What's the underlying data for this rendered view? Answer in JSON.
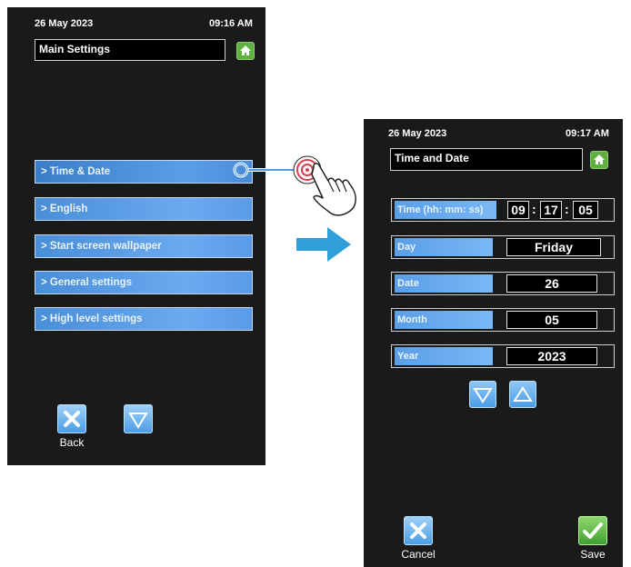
{
  "screen1": {
    "date": "26 May 2023",
    "time": "09:16 AM",
    "title": "Main Settings",
    "menu": [
      {
        "label": "> Time & Date"
      },
      {
        "label": "> English"
      },
      {
        "label": "> Start screen wallpaper"
      },
      {
        "label": "> General settings"
      },
      {
        "label": "> High level settings"
      }
    ],
    "back_label": "Back"
  },
  "screen2": {
    "date": "26 May 2023",
    "time": "09:17 AM",
    "title": "Time and Date",
    "time_label": "Time (hh: mm: ss)",
    "hh": "09",
    "mm": "17",
    "ss": "05",
    "day_label": "Day",
    "day_value": "Friday",
    "date_label": "Date",
    "date_value": "26",
    "month_label": "Month",
    "month_value": "05",
    "year_label": "Year",
    "year_value": "2023",
    "cancel_label": "Cancel",
    "save_label": "Save"
  },
  "icons": [
    "home-icon",
    "close-icon",
    "down-arrow-icon",
    "up-arrow-icon",
    "check-icon",
    "tap-hand-icon",
    "right-arrow-icon"
  ],
  "colors": {
    "button_blue": "#5a9ee8",
    "home_green": "#5fb040",
    "arrow_blue": "#2e9fd8"
  }
}
